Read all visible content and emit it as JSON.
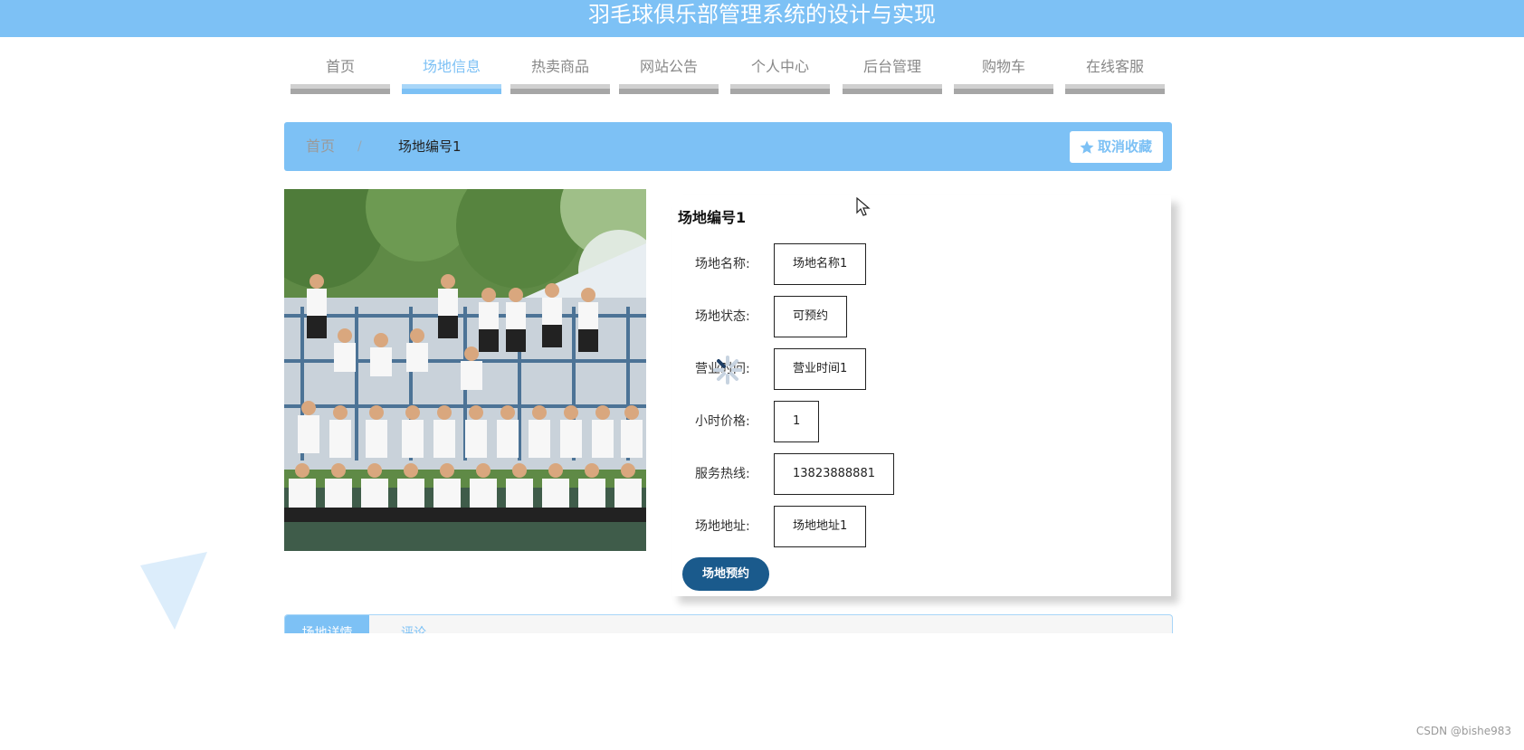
{
  "header": {
    "title": "羽毛球俱乐部管理系统的设计与实现"
  },
  "nav": {
    "items": [
      {
        "label": "首页",
        "active": false
      },
      {
        "label": "场地信息",
        "active": true
      },
      {
        "label": "热卖商品",
        "active": false
      },
      {
        "label": "网站公告",
        "active": false
      },
      {
        "label": "个人中心",
        "active": false
      },
      {
        "label": "后台管理",
        "active": false
      },
      {
        "label": "购物车",
        "active": false
      },
      {
        "label": "在线客服",
        "active": false
      }
    ]
  },
  "breadcrumb": {
    "home": "首页",
    "separator": "/",
    "current": "场地编号1"
  },
  "favorite_button": {
    "label": "取消收藏",
    "icon": "star-icon"
  },
  "venue": {
    "title": "场地编号1",
    "fields": [
      {
        "label": "场地名称:",
        "value": "场地名称1"
      },
      {
        "label": "场地状态:",
        "value": "可预约"
      },
      {
        "label": "营业时间:",
        "value": "营业时间1"
      },
      {
        "label": "小时价格:",
        "value": "1"
      },
      {
        "label": "服务热线:",
        "value": "13823888881"
      },
      {
        "label": "场地地址:",
        "value": "场地地址1"
      }
    ],
    "reserve_button": "场地预约"
  },
  "tabs": [
    {
      "label": "场地详情",
      "active": true
    },
    {
      "label": "评论",
      "active": false
    }
  ],
  "colors": {
    "primary": "#7dc1f5",
    "button_dark": "#1a5a8c",
    "nav_bar": "#a6a6a6"
  },
  "watermark": "CSDN @bishe983"
}
